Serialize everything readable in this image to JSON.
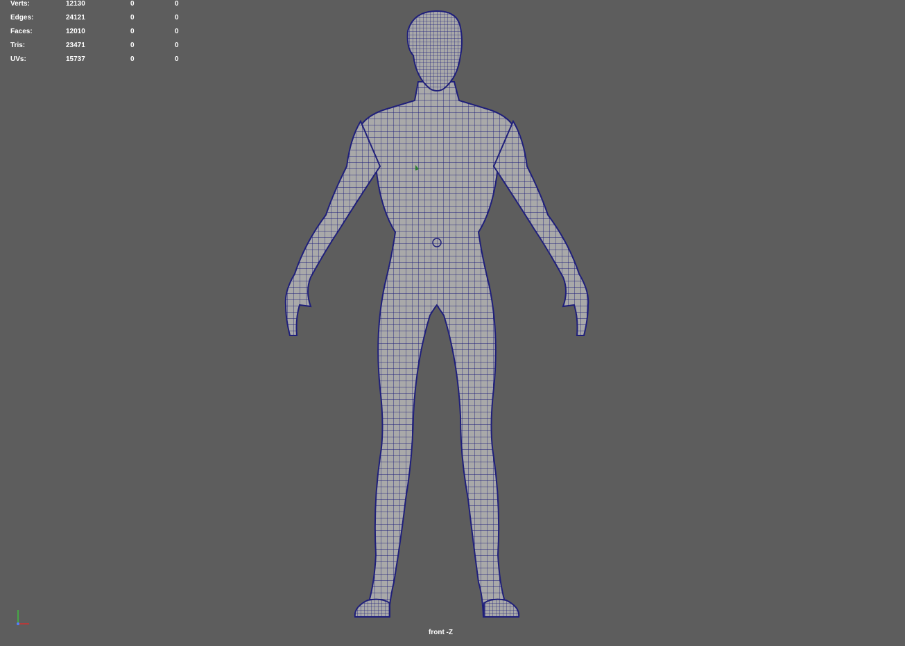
{
  "hud": {
    "rows": [
      {
        "label": "Verts:",
        "v1": "12130",
        "v2": "0",
        "v3": "0"
      },
      {
        "label": "Edges:",
        "v1": "24121",
        "v2": "0",
        "v3": "0"
      },
      {
        "label": "Faces:",
        "v1": "12010",
        "v2": "0",
        "v3": "0"
      },
      {
        "label": "Tris:",
        "v1": "23471",
        "v2": "0",
        "v3": "0"
      },
      {
        "label": "UVs:",
        "v1": "15737",
        "v2": "0",
        "v3": "0"
      }
    ]
  },
  "viewport": {
    "camera_label": "front -Z",
    "background_color": "#5d5d5d",
    "mesh_fill_color": "#a9a9a9",
    "wireframe_color": "#1f1f7a"
  },
  "axis_gizmo": {
    "x_color": "#d03030",
    "y_color": "#3fc03f"
  }
}
